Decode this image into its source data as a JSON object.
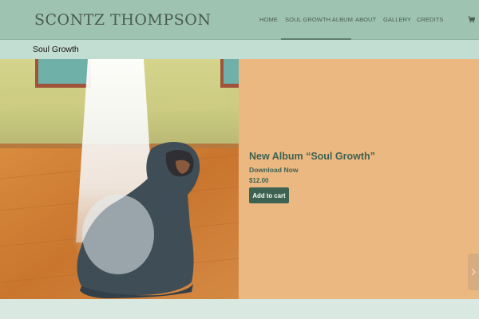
{
  "site": {
    "logo": "SCONTZ THOMPSON"
  },
  "nav": {
    "items": [
      {
        "label": "HOME"
      },
      {
        "label": "SOUL GROWTH ALBUM"
      },
      {
        "label": "ABOUT"
      },
      {
        "label": "GALLERY"
      },
      {
        "label": "CREDITS"
      }
    ],
    "active": "SOUL GROWTH ALBUM",
    "cart_icon": "cart-icon"
  },
  "page": {
    "title": "Soul Growth"
  },
  "product": {
    "title": "New Album “Soul Growth”",
    "download_label": "Download Now",
    "price": "$12.00",
    "add_to_cart_label": "Add to cart"
  },
  "colors": {
    "header_bg": "#9fc3b1",
    "title_bar_bg": "#c2ddd1",
    "main_bg": "#ecb882",
    "accent": "#3d6251",
    "footer_bg": "#d9e8e0"
  },
  "side_tab_icon": "chevron-right-icon"
}
